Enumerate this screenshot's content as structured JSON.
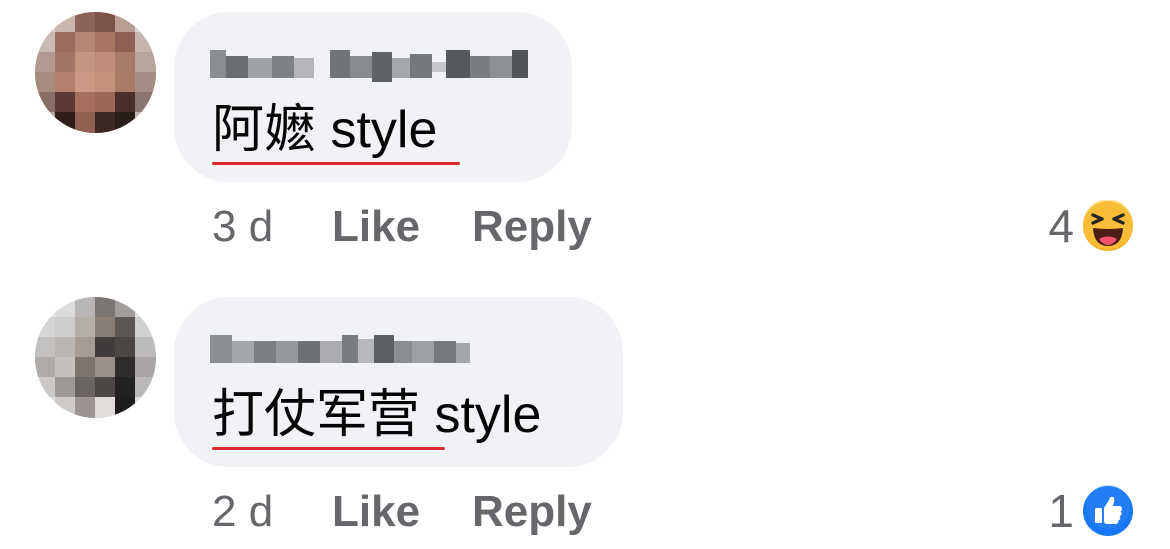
{
  "comments": [
    {
      "author_redacted": true,
      "text_cjk": "阿嬷",
      "text_latin": "style",
      "time": "3 d",
      "like_label": "Like",
      "reply_label": "Reply",
      "reaction_count": "4",
      "reaction_icon": "haha-emoji-icon"
    },
    {
      "author_redacted": true,
      "text_cjk": "打仗军营",
      "text_latin": "style",
      "time": "2 d",
      "like_label": "Like",
      "reply_label": "Reply",
      "reaction_count": "1",
      "reaction_icon": "thumbs-up-icon"
    }
  ],
  "colors": {
    "bubble": "#f0f2f5",
    "meta_text": "#65676b",
    "spellcheck_underline": "#e0262d",
    "like_blue": "#1877f2",
    "haha_yellow": "#f7b125"
  }
}
